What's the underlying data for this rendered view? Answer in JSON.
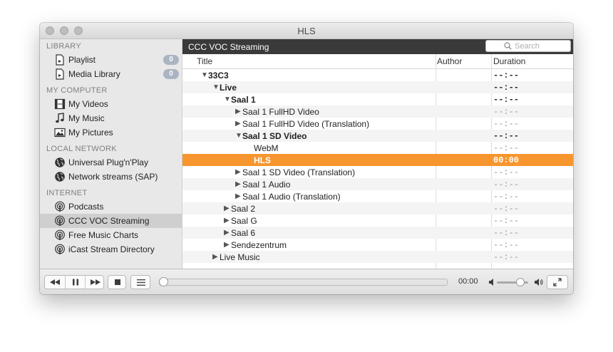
{
  "window": {
    "title": "HLS"
  },
  "sidebar": {
    "sections": [
      {
        "header": "LIBRARY",
        "items": [
          {
            "label": "Playlist",
            "icon": "document-icon",
            "badge": "0"
          },
          {
            "label": "Media Library",
            "icon": "document-icon",
            "badge": "0"
          }
        ]
      },
      {
        "header": "MY COMPUTER",
        "items": [
          {
            "label": "My Videos",
            "icon": "film-icon"
          },
          {
            "label": "My Music",
            "icon": "music-note-icon"
          },
          {
            "label": "My Pictures",
            "icon": "picture-icon"
          }
        ]
      },
      {
        "header": "LOCAL NETWORK",
        "items": [
          {
            "label": "Universal Plug'n'Play",
            "icon": "globe-icon"
          },
          {
            "label": "Network streams (SAP)",
            "icon": "globe-icon"
          }
        ]
      },
      {
        "header": "INTERNET",
        "items": [
          {
            "label": "Podcasts",
            "icon": "podcast-icon"
          },
          {
            "label": "CCC VOC Streaming",
            "icon": "podcast-icon",
            "selected": true
          },
          {
            "label": "Free Music Charts",
            "icon": "podcast-icon"
          },
          {
            "label": "iCast Stream Directory",
            "icon": "podcast-icon"
          }
        ]
      }
    ]
  },
  "main": {
    "title": "CCC VOC Streaming",
    "search_placeholder": "Search",
    "columns": {
      "title": "Title",
      "author": "Author",
      "duration": "Duration"
    },
    "rows": [
      {
        "title": "33C3",
        "level": 0,
        "expanded": true,
        "bold": true,
        "duration": "--:--"
      },
      {
        "title": "Live",
        "level": 1,
        "expanded": true,
        "bold": true,
        "duration": "--:--"
      },
      {
        "title": "Saal 1",
        "level": 2,
        "expanded": true,
        "bold": true,
        "duration": "--:--"
      },
      {
        "title": "Saal 1 FullHD Video",
        "level": 3,
        "expanded": false,
        "duration": "--:--"
      },
      {
        "title": "Saal 1 FullHD Video (Translation)",
        "level": 3,
        "expanded": false,
        "duration": "--:--"
      },
      {
        "title": "Saal 1 SD Video",
        "level": 3,
        "expanded": true,
        "bold": true,
        "duration": "--:--"
      },
      {
        "title": "WebM",
        "level": 4,
        "duration": "--:--"
      },
      {
        "title": "HLS",
        "level": 4,
        "selected": true,
        "duration": "00:00"
      },
      {
        "title": "Saal 1 SD Video (Translation)",
        "level": 3,
        "expanded": false,
        "duration": "--:--"
      },
      {
        "title": "Saal 1 Audio",
        "level": 3,
        "expanded": false,
        "duration": "--:--"
      },
      {
        "title": "Saal 1 Audio (Translation)",
        "level": 3,
        "expanded": false,
        "duration": "--:--"
      },
      {
        "title": "Saal 2",
        "level": 2,
        "expanded": false,
        "duration": "--:--"
      },
      {
        "title": "Saal G",
        "level": 2,
        "expanded": false,
        "duration": "--:--"
      },
      {
        "title": "Saal 6",
        "level": 2,
        "expanded": false,
        "duration": "--:--"
      },
      {
        "title": "Sendezentrum",
        "level": 2,
        "expanded": false,
        "duration": "--:--"
      },
      {
        "title": "Live Music",
        "level": 1,
        "expanded": false,
        "duration": "--:--"
      }
    ]
  },
  "player": {
    "elapsed": "00:00",
    "progress": 0,
    "volume": 0.75,
    "accent_color": "#f7962e"
  }
}
